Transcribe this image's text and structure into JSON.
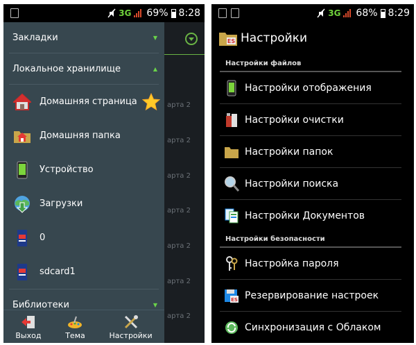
{
  "left": {
    "status": {
      "network": "3G",
      "battery": "69%",
      "time": "8:28"
    },
    "drawer": {
      "sections": {
        "bookmarks": "Закладки",
        "local_storage": "Локальное хранилище",
        "libraries": "Библиотеки"
      },
      "items": [
        {
          "label": "Домашняя страница",
          "icon": "home-icon"
        },
        {
          "label": "Домашняя папка",
          "icon": "home-folder-icon"
        },
        {
          "label": "Устройство",
          "icon": "device-icon"
        },
        {
          "label": "Загрузки",
          "icon": "download-icon"
        },
        {
          "label": "0",
          "icon": "sdcard-icon"
        },
        {
          "label": "sdcard1",
          "icon": "sdcard-icon"
        }
      ]
    },
    "toolbar": {
      "exit": "Выход",
      "theme": "Тема",
      "settings": "Настройки"
    },
    "background_rows": [
      "арта 2",
      "арта 2",
      "арта 2",
      "арта 2",
      "арта 2",
      "арта 2",
      "арта 2"
    ]
  },
  "right": {
    "status": {
      "network": "3G",
      "battery": "68%",
      "time": "8:29"
    },
    "title": "Настройки",
    "groups": [
      {
        "header": "Настройки файлов",
        "items": [
          {
            "label": "Настройки отображения",
            "icon": "phone-display-icon"
          },
          {
            "label": "Настройки очистки",
            "icon": "cleaning-icon"
          },
          {
            "label": "Настройки папок",
            "icon": "folder-icon"
          },
          {
            "label": "Настройки поиска",
            "icon": "magnifier-icon"
          },
          {
            "label": "Настройки Документов",
            "icon": "documents-icon"
          }
        ]
      },
      {
        "header": "Настройки безопасности",
        "items": [
          {
            "label": "Настройка пароля",
            "icon": "keys-icon"
          },
          {
            "label": "Резервирование настроек",
            "icon": "backup-icon"
          },
          {
            "label": "Синхронизация с Облаком",
            "icon": "cloud-sync-icon"
          }
        ]
      }
    ]
  }
}
